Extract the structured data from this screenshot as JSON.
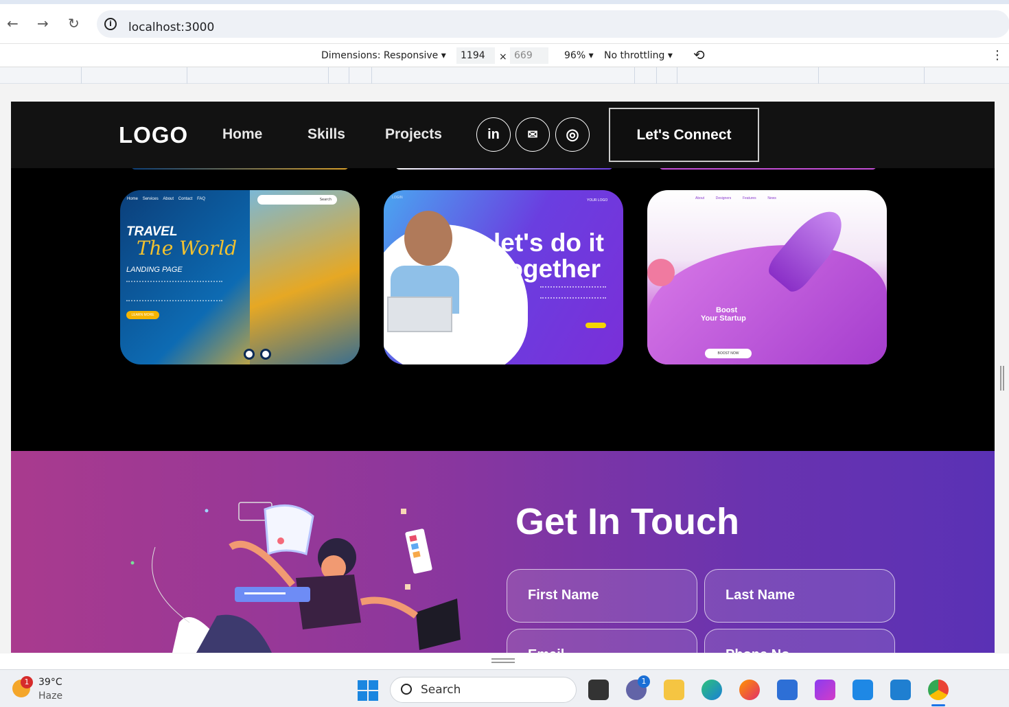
{
  "browser": {
    "url": "localhost:3000",
    "back_icon": "arrow-left-icon",
    "forward_icon": "arrow-right-icon",
    "reload_icon": "reload-icon"
  },
  "devtools": {
    "dimensions_label": "Dimensions: Responsive",
    "width": "1194",
    "times": "×",
    "height": "669",
    "zoom": "96%",
    "throttling": "No throttling",
    "more": "⋮"
  },
  "nav": {
    "logo": "LOGO",
    "links": [
      "Home",
      "Skills",
      "Projects"
    ],
    "social": [
      "in",
      "✉",
      "◎"
    ],
    "connect": "Let's Connect"
  },
  "projects": {
    "card1": {
      "title1": "TRAVEL",
      "title2": "The World",
      "subtitle": "LANDING PAGE",
      "menu": [
        "Home",
        "Services",
        "About",
        "Contact",
        "FAQ"
      ],
      "search": "Search",
      "cta": "LEARN MORE"
    },
    "card2": {
      "headline1": "let's do it",
      "headline2": "together",
      "brand": "YOUR LOGO",
      "menu": [
        "LOGIN"
      ]
    },
    "card3": {
      "title1": "Boost",
      "title2": "Your Startup",
      "menu": [
        "About",
        "Designers",
        "Features",
        "News"
      ],
      "cta": "BOOST NOW"
    }
  },
  "contact": {
    "heading": "Get In Touch",
    "first_name": "First Name",
    "last_name": "Last Name",
    "email": "Email",
    "phone": "Phone No."
  },
  "taskbar": {
    "temperature": "39°C",
    "weather": "Haze",
    "weather_badge": "1",
    "search": "Search",
    "chat_badge": "1"
  }
}
